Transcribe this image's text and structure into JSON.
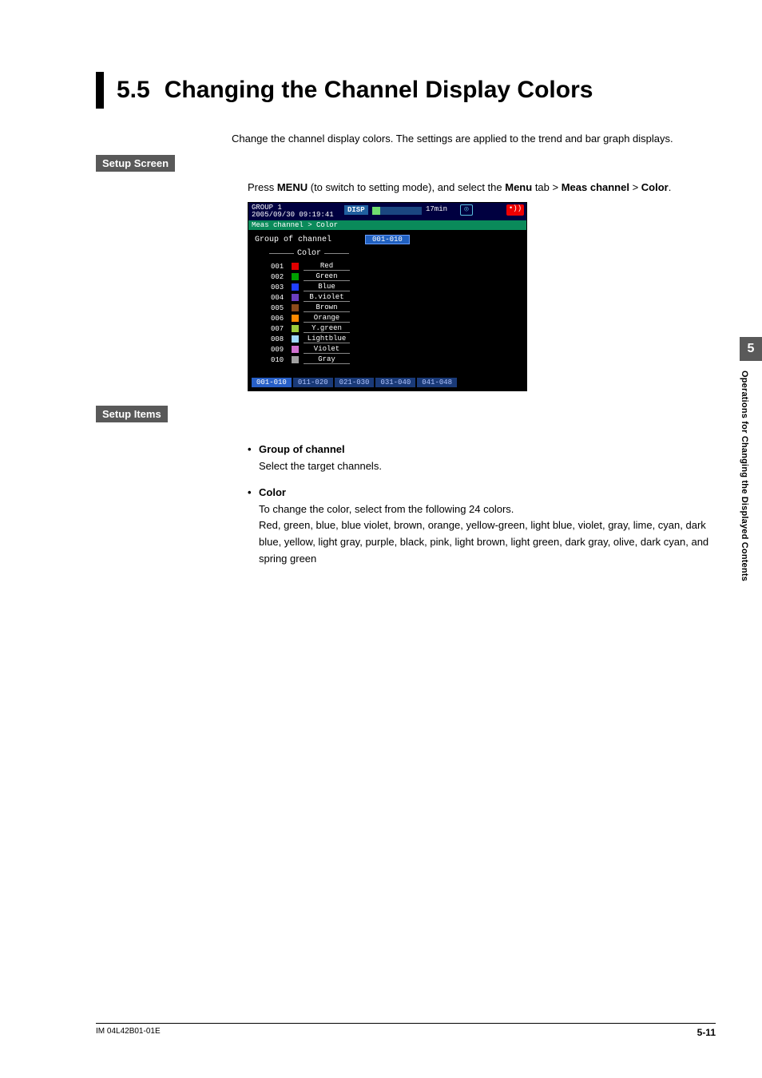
{
  "section_number": "5.5",
  "section_title": "Changing the Channel Display Colors",
  "intro": "Change the channel display colors. The settings are applied to the trend and bar graph displays.",
  "setup_screen_label": "Setup Screen",
  "press_line": {
    "pre": "Press ",
    "menu1": "MENU",
    "mid1": " (to switch to setting mode), and select the ",
    "menu2": "Menu",
    "mid2": " tab > ",
    "menu3": "Meas channel",
    "mid3": " > ",
    "menu4": "Color",
    "end": "."
  },
  "screenshot": {
    "group": "GROUP 1",
    "timestamp": "2005/09/30 09:19:41",
    "disp": "DISP",
    "duration": "17min",
    "status_icon": "◎",
    "rec_icon": "•))",
    "breadcrumb": "Meas channel > Color",
    "field_label": "Group of channel",
    "field_value": "001-010",
    "color_label": "Color",
    "rows": [
      {
        "ch": "001",
        "swatch": "#e00000",
        "name": "Red"
      },
      {
        "ch": "002",
        "swatch": "#00a000",
        "name": "Green"
      },
      {
        "ch": "003",
        "swatch": "#2040ff",
        "name": "Blue"
      },
      {
        "ch": "004",
        "swatch": "#6a3fc0",
        "name": "B.violet"
      },
      {
        "ch": "005",
        "swatch": "#8a4a1a",
        "name": "Brown"
      },
      {
        "ch": "006",
        "swatch": "#ff8a00",
        "name": "Orange"
      },
      {
        "ch": "007",
        "swatch": "#9ccc3c",
        "name": "Y.green"
      },
      {
        "ch": "008",
        "swatch": "#9fd8ff",
        "name": "Lightblue"
      },
      {
        "ch": "009",
        "swatch": "#d070d0",
        "name": "Violet"
      },
      {
        "ch": "010",
        "swatch": "#a0a0a0",
        "name": "Gray"
      }
    ],
    "tabs": [
      "001-010",
      "011-020",
      "021-030",
      "031-040",
      "041-048"
    ]
  },
  "setup_items_label": "Setup Items",
  "items": [
    {
      "title": "Group of channel",
      "desc": [
        "Select the target channels."
      ]
    },
    {
      "title": "Color",
      "desc": [
        "To change the color, select from the following 24 colors.",
        "Red, green, blue, blue violet, brown, orange, yellow-green, light blue, violet, gray, lime, cyan, dark blue, yellow, light gray, purple, black, pink, light brown, light green, dark gray, olive, dark cyan, and spring green"
      ]
    }
  ],
  "side": {
    "chapter": "5",
    "text": "Operations for Changing the Displayed Contents"
  },
  "footer": {
    "left": "IM 04L42B01-01E",
    "right": "5-11"
  }
}
